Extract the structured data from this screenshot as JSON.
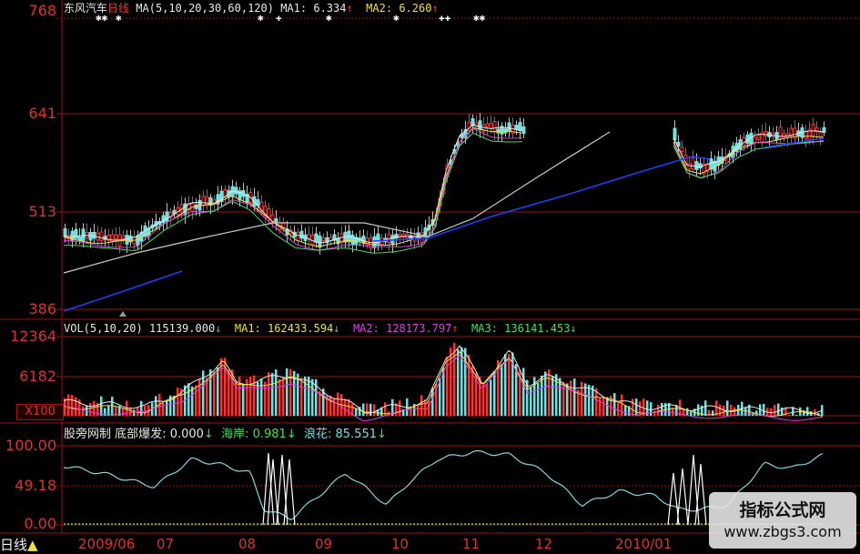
{
  "price_panel": {
    "stock_name": "东风汽车",
    "period": "日线",
    "ma_params": "MA(5,10,20,30,60,120)",
    "ma1_label": "MA1:",
    "ma1_value": "6.334",
    "ma2_label": "MA2:",
    "ma2_value": "6.260",
    "y_labels": [
      "768",
      "641",
      "513",
      "386"
    ]
  },
  "vol_panel": {
    "title": "VOL(5,10,20)",
    "vol_value": "115139.000",
    "ma1_label": "MA1:",
    "ma1_value": "162433.594",
    "ma2_label": "MA2:",
    "ma2_value": "128173.797",
    "ma3_label": "MA3:",
    "ma3_value": "136141.453",
    "y_labels": [
      "12364",
      "6182"
    ],
    "multiplier": "X100"
  },
  "ind_panel": {
    "title": "股旁网制",
    "s1_label": "底部爆发:",
    "s1_value": "0.000",
    "s2_label": "海岸:",
    "s2_value": "0.981",
    "s3_label": "浪花:",
    "s3_value": "85.551",
    "y_labels": [
      "100.00",
      "49.18",
      "0.00"
    ]
  },
  "x_axis": {
    "period_tag": "日线",
    "labels": [
      "2009/06",
      "07",
      "08",
      "09",
      "10",
      "11",
      "12",
      "2010/01"
    ]
  },
  "watermark": {
    "line1": "指标公式网",
    "line2": "www.zbgs3.com"
  },
  "colors": {
    "up": "#ff3030",
    "down": "#70e0e0",
    "ma5": "#e8e8e8",
    "ma10": "#f0e040",
    "ma20": "#e040e0",
    "ma30": "#40e060",
    "ma60": "#c8c8c8",
    "ma120": "#2040ff",
    "grid": "#a01010"
  }
}
